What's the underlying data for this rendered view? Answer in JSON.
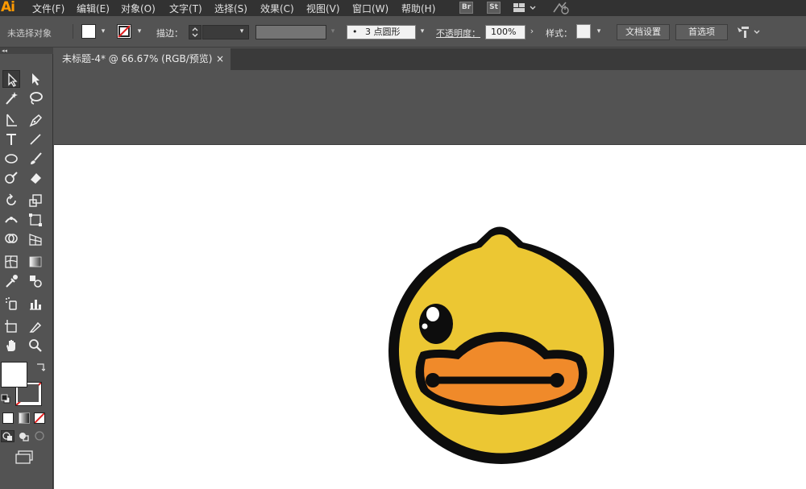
{
  "app": {
    "logo": "Ai"
  },
  "menu": {
    "items": [
      "文件(F)",
      "编辑(E)",
      "对象(O)",
      "文字(T)",
      "选择(S)",
      "效果(C)",
      "视图(V)",
      "窗口(W)",
      "帮助(H)"
    ],
    "bridge_badge": "Br",
    "stock_badge": "St"
  },
  "control_bar": {
    "selection_status": "未选择对象",
    "stroke_label": "描边",
    "stroke_weight_value": "",
    "brush_value": "3 点圆形",
    "brush_dot": "•",
    "opacity_label": "不透明度",
    "opacity_value": "100%",
    "style_label": "样式",
    "doc_setup_button": "文档设置",
    "preferences_button": "首选项"
  },
  "tools": {
    "panel_collapse": "◂◂"
  },
  "document": {
    "tab_title": "未标题-4* @ 66.67% (RGB/预览)",
    "close_glyph": "×"
  },
  "colors": {
    "duck_yellow": "#ecc733",
    "beak_orange": "#f08a2a",
    "outline": "#0d0d0d",
    "artboard": "#ffffff",
    "app_bg": "#535353"
  }
}
